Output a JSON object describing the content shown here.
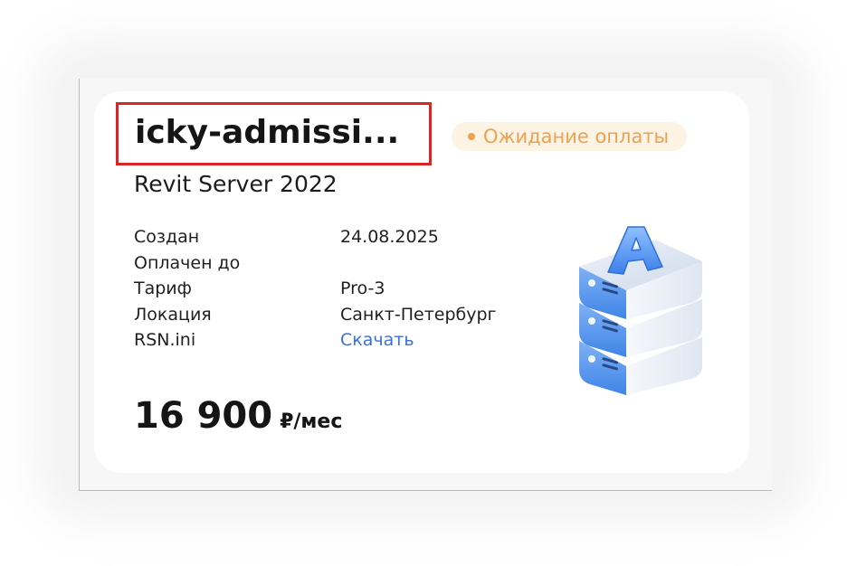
{
  "server": {
    "name": "icky-admissi...",
    "status": "Ожидание оплаты",
    "product": "Revit Server 2022",
    "details": [
      {
        "label": "Создан",
        "value": "24.08.2025"
      },
      {
        "label": "Оплачен до",
        "value": ""
      },
      {
        "label": "Тариф",
        "value": "Pro-3"
      },
      {
        "label": "Локация",
        "value": "Санкт-Петербург"
      },
      {
        "label": "RSN.ini",
        "value": "Скачать"
      }
    ],
    "price": "16 900",
    "price_unit": "₽/мес"
  },
  "colors": {
    "status": "#eda24f",
    "status_bg": "#fdf3e5",
    "link": "#3b6fe0",
    "highlight": "#d92525"
  },
  "icons": {
    "status": "status-dot-icon",
    "illustration": "server-stack-icon"
  }
}
